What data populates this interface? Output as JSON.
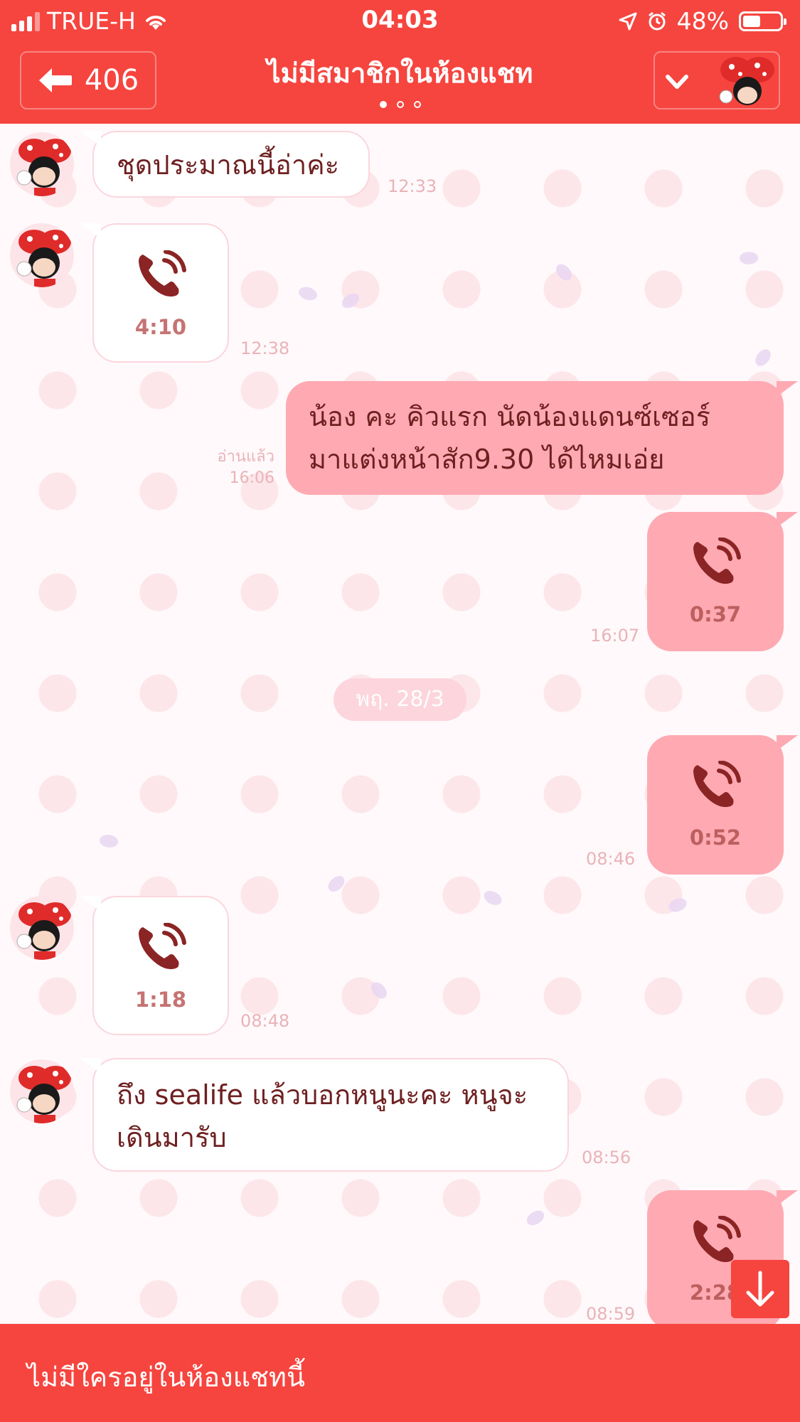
{
  "status_bar": {
    "carrier": "TRUE-H",
    "time": "04:03",
    "battery": "48%",
    "battery_level": 0.48
  },
  "header": {
    "back_count": "406",
    "title": "ไม่มีสมาชิกในห้องแชท",
    "page_index": 0,
    "page_count": 3
  },
  "messages": [
    {
      "side": "in",
      "type": "text",
      "text": "ชุดประมาณนี้อ่าค่ะ",
      "time": "12:33"
    },
    {
      "side": "in",
      "type": "call",
      "duration": "4:10",
      "time": "12:38"
    },
    {
      "side": "out",
      "type": "text",
      "lines": [
        "น้อง     คะ คิวแรก นัดน้องแดนซ์เซอร์",
        "มาแต่งหน้าสัก9.30 ได้ไหมเอ่ย"
      ],
      "read": "อ่านแล้ว",
      "time": "16:06"
    },
    {
      "side": "out",
      "type": "call",
      "duration": "0:37",
      "time": "16:07"
    },
    {
      "side": "out",
      "type": "call",
      "duration": "0:52",
      "time": "08:46"
    },
    {
      "side": "in",
      "type": "call",
      "duration": "1:18",
      "time": "08:48"
    },
    {
      "side": "in",
      "type": "text",
      "lines": [
        "ถึง sealife แล้วบอกหนูนะคะ หนูจะ",
        "เดินมารับ"
      ],
      "time": "08:56"
    },
    {
      "side": "out",
      "type": "call",
      "duration": "2:28",
      "time": "08:59"
    }
  ],
  "date_separator": "พฤ. 28/3",
  "footer": {
    "text": "ไม่มีใครอยู่ในห้องแชทนี้"
  },
  "colors": {
    "brand_red": "#f6443f",
    "outgoing_bubble": "#ffaab2",
    "incoming_bubble": "#ffffff",
    "message_text": "#6e1f1f"
  },
  "icons": [
    "back-arrow-icon",
    "chevron-down-icon",
    "phone-call-icon",
    "arrow-down-icon",
    "wifi-icon",
    "location-icon",
    "alarm-icon"
  ]
}
